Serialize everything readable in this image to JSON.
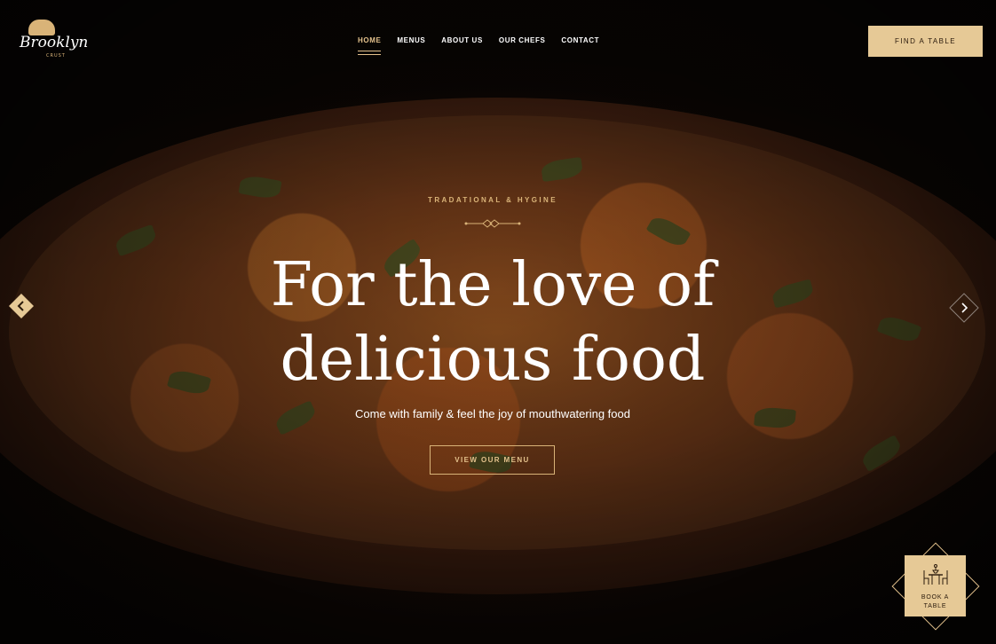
{
  "brand": {
    "logo_text": "Brooklyn",
    "logo_sub": "CRUST"
  },
  "nav": {
    "items": [
      {
        "label": "HOME",
        "active": true
      },
      {
        "label": "MENUS",
        "active": false
      },
      {
        "label": "ABOUT US",
        "active": false
      },
      {
        "label": "OUR CHEFS",
        "active": false
      },
      {
        "label": "CONTACT",
        "active": false
      }
    ]
  },
  "header": {
    "cta_label": "FIND A TABLE"
  },
  "hero": {
    "eyebrow": "TRADATIONAL & HYGINE",
    "headline_line1": "For the love of",
    "headline_line2": "delicious food",
    "subtext": "Come with family & feel the joy of mouthwatering food",
    "cta_label": "VIEW OUR MENU"
  },
  "slider": {
    "prev_icon": "chevron-left-icon",
    "next_icon": "chevron-right-icon"
  },
  "booking_widget": {
    "icon": "dining-table-icon",
    "label_line1": "BOOK A",
    "label_line2": "TABLE"
  },
  "colors": {
    "accent": "#e6c996",
    "accent_text": "#d9b378",
    "dark_text": "#2a1a0c",
    "background": "#0a0705"
  }
}
